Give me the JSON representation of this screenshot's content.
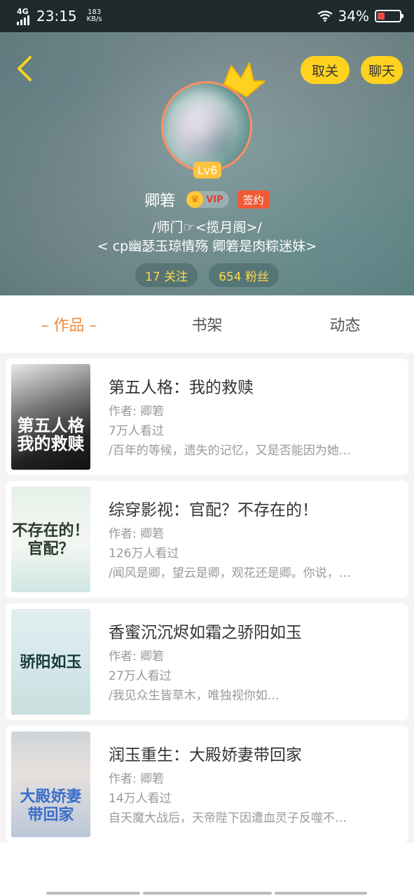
{
  "status_bar": {
    "network": "4G",
    "time": "23:15",
    "speed_value": "183",
    "speed_unit": "KB/s",
    "battery": "34%",
    "battery_level": 0.34,
    "battery_color": "#e64a4a"
  },
  "header": {
    "back_icon": "chevron-left-icon",
    "unfollow_label": "取关",
    "chat_label": "聊天",
    "level": "Lv6",
    "username": "卿箬",
    "vip_label": "VIP",
    "signed_label": "签约",
    "bio_line1": "/师门☞<揽月阁>/",
    "bio_line2": "< cp幽瑟玉琼情殇 卿箬是肉粽迷妹>",
    "following": "17 关注",
    "followers": "654 粉丝",
    "accent_color": "#ffd21f"
  },
  "tabs": [
    {
      "label": "– 作品 –",
      "active": true
    },
    {
      "label": "书架",
      "active": false
    },
    {
      "label": "动态",
      "active": false
    }
  ],
  "books": [
    {
      "cover_text": "第五人格\n我的救赎",
      "title": "第五人格：我的救赎",
      "author": "作者: 卿箬",
      "views": "7万人看过",
      "desc": "/百年的等候，遗失的记忆，又是否能因为她…"
    },
    {
      "cover_text": "不存在的！\n官配？",
      "title": "综穿影视：官配？不存在的！",
      "author": "作者: 卿箬",
      "views": "126万人看过",
      "desc": "/闻风是卿，望云是卿，观花还是卿。你说，…"
    },
    {
      "cover_text": "骄阳如玉",
      "title": "香蜜沉沉烬如霜之骄阳如玉",
      "author": "作者: 卿箬",
      "views": "27万人看过",
      "desc": "/我见众生皆草木，唯独视你如…"
    },
    {
      "cover_text": "大殿娇妻\n带回家",
      "title": "润玉重生：大殿娇妻带回家",
      "author": "作者: 卿箬",
      "views": "14万人看过",
      "desc": "自天魔大战后，天帝陛下因遭血灵子反噬不…"
    }
  ]
}
